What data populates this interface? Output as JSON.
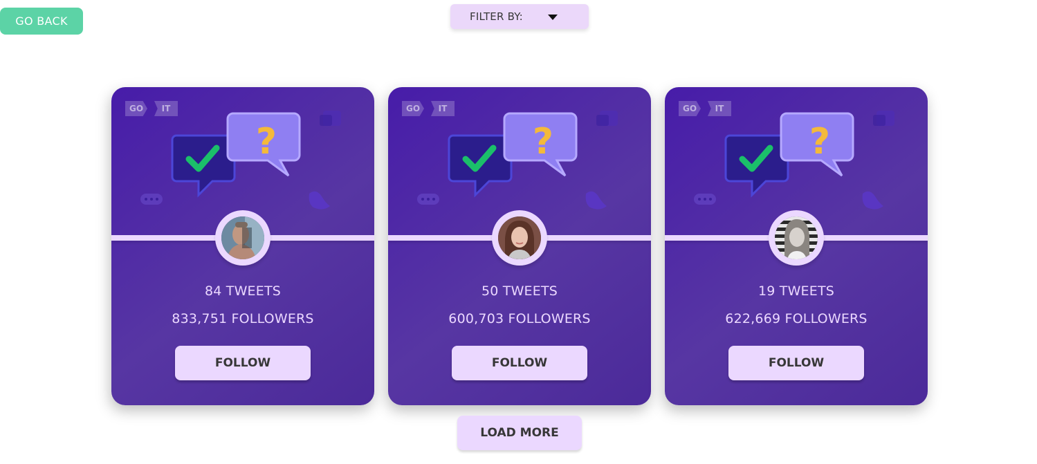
{
  "header": {
    "go_back_label": "GO BACK",
    "filter_label": "FILTER BY:"
  },
  "logo": {
    "go": "GO",
    "it": "IT"
  },
  "cards": [
    {
      "tweets": "84 TWEETS",
      "followers": "833,751 FOLLOWERS",
      "button_label": "FOLLOW",
      "avatar": "man-portrait"
    },
    {
      "tweets": "50 TWEETS",
      "followers": "600,703 FOLLOWERS",
      "button_label": "FOLLOW",
      "avatar": "woman-portrait"
    },
    {
      "tweets": "19 TWEETS",
      "followers": "622,669 FOLLOWERS",
      "button_label": "FOLLOW",
      "avatar": "woman-bw-portrait"
    }
  ],
  "load_more_label": "LOAD MORE",
  "colors": {
    "go_back": "#5cd3a6",
    "accent_light": "#ebd8ff",
    "card_purple": "#5736a3",
    "text_dark": "#373737"
  }
}
